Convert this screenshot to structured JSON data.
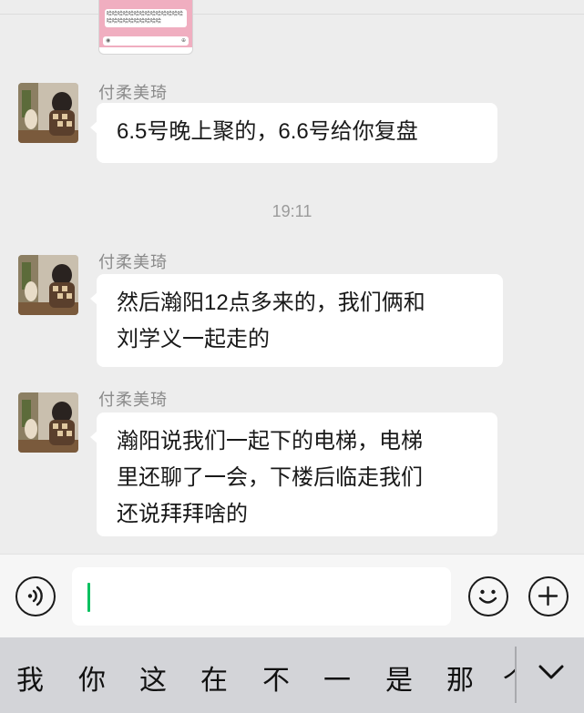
{
  "preview": {
    "card_text": "哈哈哈哈哈哈哈哈哈哈哈哈哈哈哈哈哈哈哈哈哈哈哈哈",
    "left_icon": "voice-icon",
    "right_icon": "plus-icon"
  },
  "messages": [
    {
      "sender": "付柔美琦",
      "lines": [
        "6.5号晚上聚的，6.6号给你复盘"
      ]
    },
    {
      "sender": "付柔美琦",
      "lines": [
        "然后瀚阳12点多来的，我们俩和",
        "刘学义一起走的"
      ]
    },
    {
      "sender": "付柔美琦",
      "lines": [
        "瀚阳说我们一起下的电梯，电梯",
        "里还聊了一会，下楼后临走我们",
        "还说拜拜啥的"
      ]
    }
  ],
  "timestamp": "19:11",
  "input": {
    "value": "",
    "cursor_color": "#07c160"
  },
  "keyboard": {
    "candidates": [
      "我",
      "你",
      "这",
      "在",
      "不",
      "一",
      "是",
      "那"
    ],
    "partial_candidate": "个"
  },
  "colors": {
    "background": "#ededed",
    "bubble": "#ffffff",
    "accent": "#07c160"
  }
}
